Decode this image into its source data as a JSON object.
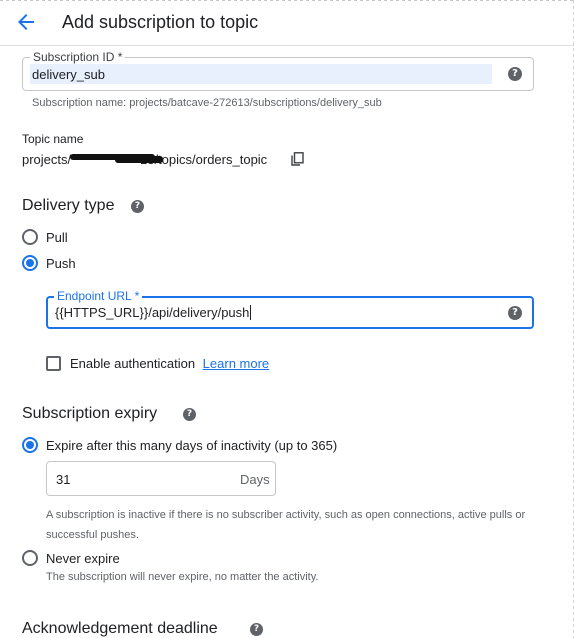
{
  "header": {
    "title": "Add subscription to topic"
  },
  "subscription_id": {
    "label": "Subscription ID *",
    "value": "delivery_sub",
    "hint": "Subscription name: projects/batcave-272613/subscriptions/delivery_sub"
  },
  "topic": {
    "label": "Topic name",
    "value_prefix": "projects/",
    "value_suffix": "13/topics/orders_topic"
  },
  "delivery": {
    "title": "Delivery type",
    "options": [
      "Pull",
      "Push"
    ],
    "selected": "Push",
    "endpoint_label": "Endpoint URL *",
    "endpoint_value": "{{HTTPS_URL}}/api/delivery/push",
    "auth_label": "Enable authentication",
    "learn_more": "Learn more"
  },
  "expiry": {
    "title": "Subscription expiry",
    "option_days": "Expire after this many days of inactivity (up to 365)",
    "days_value": "31",
    "days_unit": "Days",
    "days_hint": "A subscription is inactive if there is no subscriber activity, such as open connections, active pulls or successful pushes.",
    "option_never": "Never expire",
    "never_hint": "The subscription will never expire, no matter the activity.",
    "selected": "days"
  },
  "ack": {
    "title": "Acknowledgement deadline"
  },
  "colors": {
    "accent": "#1a73e8",
    "text": "#202124",
    "muted": "#5f6368"
  }
}
